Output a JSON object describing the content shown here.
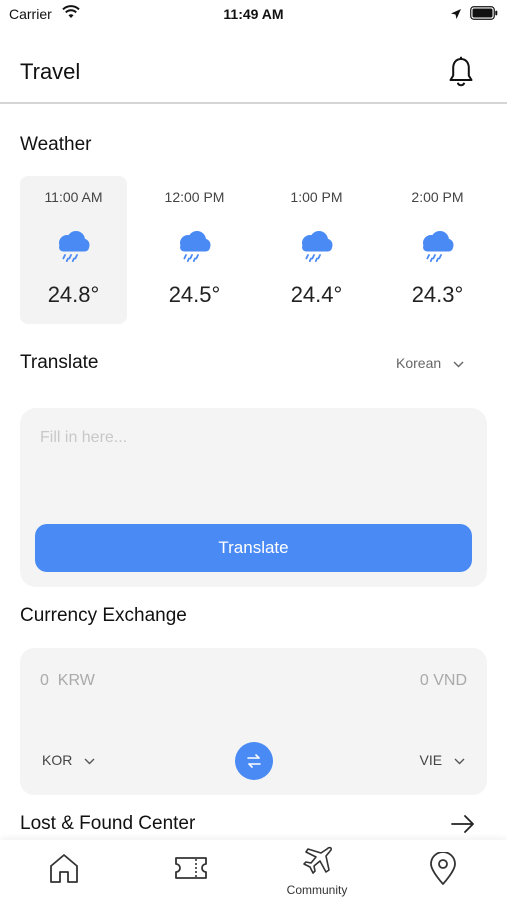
{
  "status_bar": {
    "carrier": "Carrier",
    "time": "11:49 AM",
    "icons": [
      "wifi-icon",
      "location-arrow-icon",
      "battery-icon"
    ]
  },
  "header": {
    "title": "Travel",
    "icon": "bell-icon"
  },
  "weather": {
    "title": "Weather",
    "items": [
      {
        "time": "11:00 AM",
        "temp": "24.8°",
        "icon": "rain-cloud-icon"
      },
      {
        "time": "12:00 PM",
        "temp": "24.5°",
        "icon": "rain-cloud-icon"
      },
      {
        "time": "1:00 PM",
        "temp": "24.4°",
        "icon": "rain-cloud-icon"
      },
      {
        "time": "2:00 PM",
        "temp": "24.3°",
        "icon": "rain-cloud-icon"
      }
    ]
  },
  "translate": {
    "title": "Translate",
    "language": "Korean",
    "input_placeholder": "Fill in here...",
    "input_value": "",
    "button_label": "Translate"
  },
  "currency": {
    "title": "Currency Exchange",
    "from_amount": "0  KRW",
    "to_amount": "0 VND",
    "from_country": "KOR",
    "to_country": "VIE"
  },
  "lost_found": {
    "title": "Lost & Found Center"
  },
  "tabbar": {
    "tabs": [
      {
        "icon": "home-icon",
        "label": ""
      },
      {
        "icon": "ticket-icon",
        "label": ""
      },
      {
        "icon": "airplane-icon",
        "label": "Community"
      },
      {
        "icon": "map-pin-icon",
        "label": ""
      }
    ]
  },
  "colors": {
    "accent": "#4a8af4",
    "card_background": "#f4f4f4",
    "weather_icon": "#4a8af4"
  }
}
